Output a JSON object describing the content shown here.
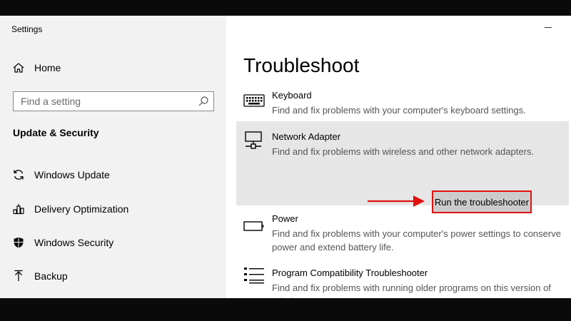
{
  "window": {
    "title": "Settings"
  },
  "sidebar": {
    "home_label": "Home",
    "search": {
      "placeholder": "Find a setting",
      "value": ""
    },
    "section_heading": "Update & Security",
    "items": [
      {
        "label": "Windows Update",
        "icon": "refresh-icon"
      },
      {
        "label": "Delivery Optimization",
        "icon": "delivery-optimization-icon"
      },
      {
        "label": "Windows Security",
        "icon": "shield-icon"
      },
      {
        "label": "Backup",
        "icon": "backup-arrow-icon"
      }
    ]
  },
  "main": {
    "title": "Troubleshoot",
    "troubleshooters": [
      {
        "name": "Keyboard",
        "description": "Find and fix problems with your computer's keyboard settings.",
        "icon": "keyboard-icon"
      },
      {
        "name": "Network Adapter",
        "description": "Find and fix problems with wireless and other network adapters.",
        "icon": "network-adapter-icon",
        "selected": true
      },
      {
        "name": "Power",
        "description": "Find and fix problems with your computer's power settings to conserve power and extend battery life.",
        "icon": "battery-icon"
      },
      {
        "name": "Program Compatibility Troubleshooter",
        "description": "Find and fix problems with running older programs on this version of Windows.",
        "icon": "program-list-icon"
      }
    ],
    "run_button_label": "Run the troubleshooter"
  },
  "colors": {
    "highlight_red": "#e01010",
    "selected_item_bg": "#e6e6e6",
    "sidebar_bg": "#f2f2f2",
    "frame_bg": "#0a0a0a"
  }
}
